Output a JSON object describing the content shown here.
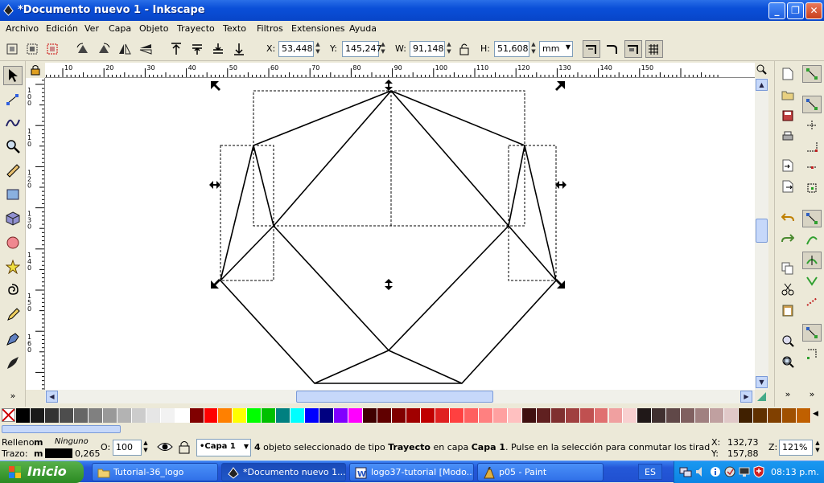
{
  "window": {
    "title": "*Documento nuevo 1 - Inkscape",
    "min_label": "_",
    "max_label": "❐",
    "close_label": "✕"
  },
  "menu": [
    "Archivo",
    "Edición",
    "Ver",
    "Capa",
    "Objeto",
    "Trayecto",
    "Texto",
    "Filtros",
    "Extensiones",
    "Ayuda"
  ],
  "toolbar": {
    "x_label": "X:",
    "x_value": "53,448",
    "y_label": "Y:",
    "y_value": "145,247",
    "w_label": "W:",
    "w_value": "91,148",
    "h_label": "H:",
    "h_value": "51,608",
    "unit": "mm"
  },
  "ruler_top": [
    "10",
    "20",
    "30",
    "40",
    "50",
    "60",
    "70",
    "80",
    "90",
    "100",
    "110",
    "120",
    "130",
    "140",
    "150"
  ],
  "ruler_left": [
    "100",
    "110",
    "120",
    "130",
    "140",
    "150",
    "160"
  ],
  "palette_colors": [
    "#000000",
    "#1a1a1a",
    "#333333",
    "#4d4d4d",
    "#666666",
    "#808080",
    "#999999",
    "#b3b3b3",
    "#cccccc",
    "#e6e6e6",
    "#f2f2f2",
    "#ffffff",
    "#800000",
    "#ff0000",
    "#ff8000",
    "#ffff00",
    "#00ff00",
    "#00c000",
    "#008080",
    "#00ffff",
    "#0000ff",
    "#000080",
    "#8000ff",
    "#ff00ff",
    "#400000",
    "#600000",
    "#800000",
    "#a00000",
    "#c00000",
    "#e02020",
    "#ff4040",
    "#ff6060",
    "#ff8080",
    "#ffa0a0",
    "#ffc0c0",
    "#401010",
    "#602020",
    "#803030",
    "#a04040",
    "#c05050",
    "#e07070",
    "#f0a0a0",
    "#f8d0d0",
    "#201818",
    "#403030",
    "#604848",
    "#806060",
    "#a08080",
    "#c0a0a0",
    "#e0c8c8",
    "#402000",
    "#603000",
    "#804000",
    "#a05000",
    "#c06000"
  ],
  "status": {
    "fill_label": "Relleno:",
    "fill_value": "m",
    "fill_none": "Ninguno",
    "stroke_label": "Trazo:",
    "stroke_value": "m",
    "stroke_width": "0,265",
    "opacity_label": "O:",
    "opacity_value": "100",
    "layer": "•Capa 1",
    "message_count": "4",
    "message_a": " objeto seleccionado de tipo ",
    "message_type": "Trayecto",
    "message_b": " en capa ",
    "message_layer": "Capa 1",
    "message_c": ". Pulse en la selección para conmutar los tiradores de esca…",
    "cursor_x_label": "X:",
    "cursor_x": "132,73",
    "cursor_y_label": "Y:",
    "cursor_y": "157,88",
    "zoom_label": "Z:",
    "zoom_value": "121%"
  },
  "taskbar": {
    "start": "Inicio",
    "tasks": [
      "Tutorial-36_logo",
      "*Documento nuevo 1....",
      "logo37-tutorial [Modo...",
      "p05 - Paint"
    ],
    "lang": "ES",
    "clock": "08:13 p.m."
  }
}
